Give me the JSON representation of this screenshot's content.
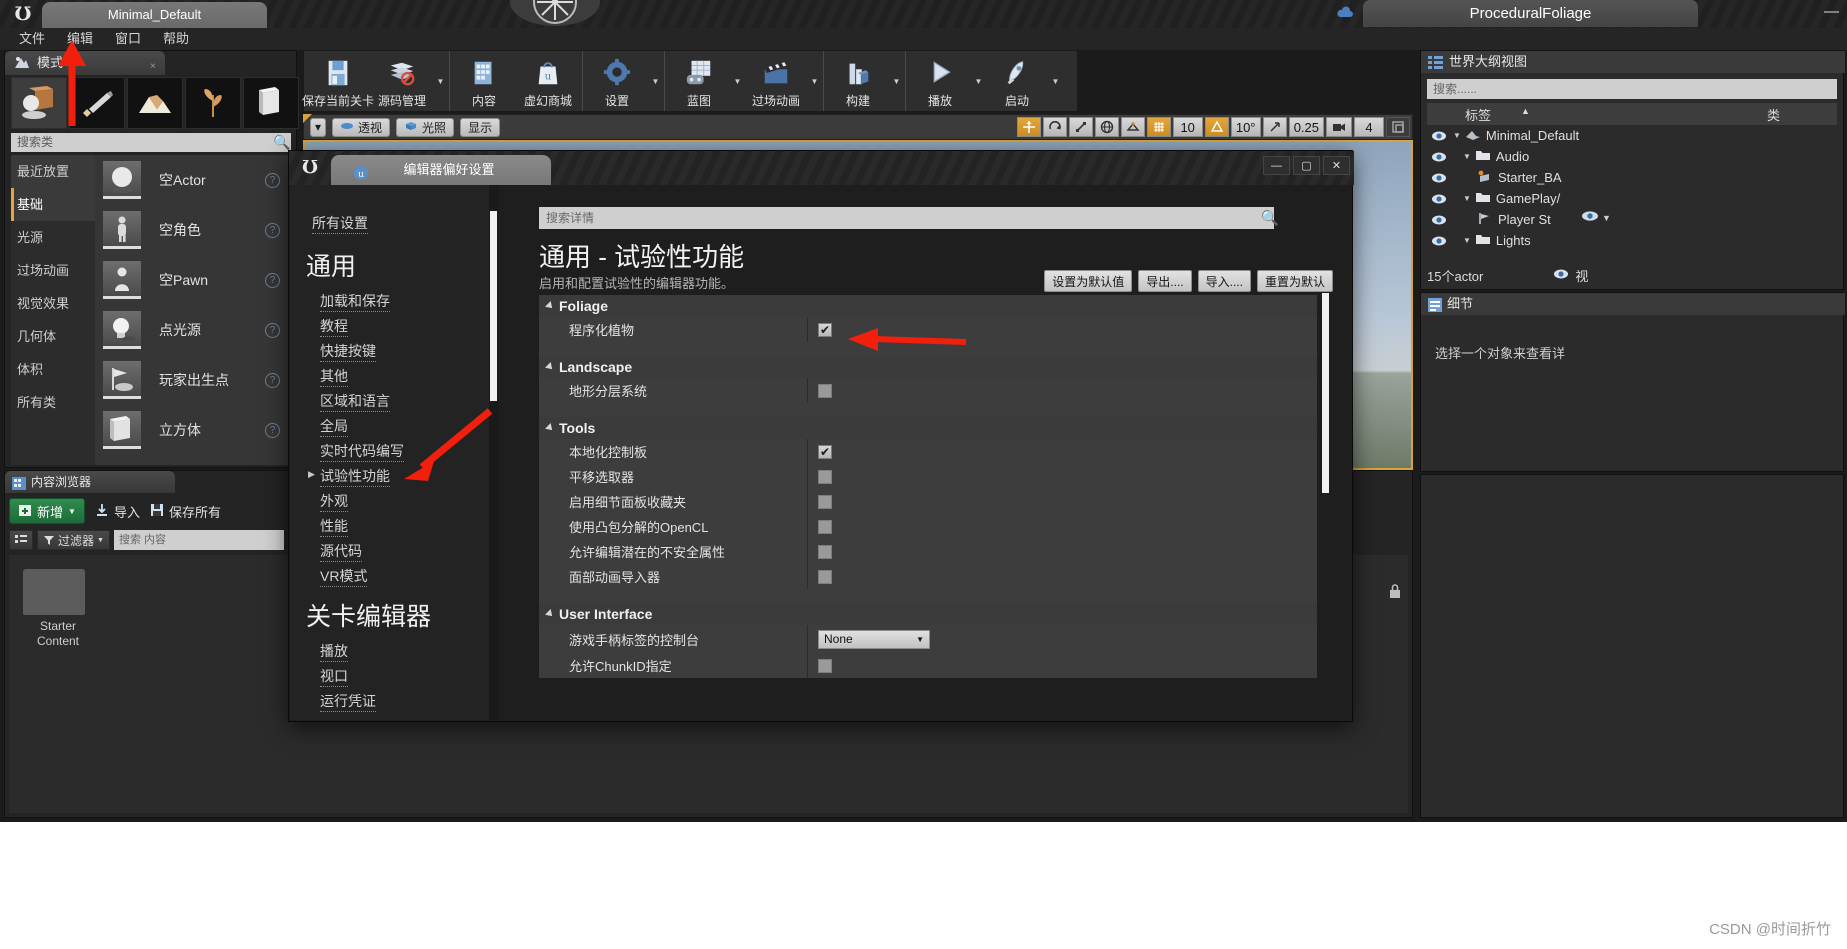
{
  "titlebar": {
    "project_tab": "Minimal_Default",
    "right_tab": "ProceduralFoliage",
    "logo": "Ʊ"
  },
  "menubar": {
    "items": [
      "文件",
      "编辑",
      "窗口",
      "帮助"
    ]
  },
  "modes_panel": {
    "tab_label": "模式",
    "close": "×",
    "mode_buttons": [
      {
        "name": "place-mode",
        "icon": "box-sphere"
      },
      {
        "name": "paint-mode",
        "icon": "brush"
      },
      {
        "name": "landscape-mode",
        "icon": "mountains"
      },
      {
        "name": "foliage-mode",
        "icon": "leaf"
      },
      {
        "name": "geometry-mode",
        "icon": "cube"
      }
    ],
    "search_placeholder": "搜索类",
    "categories": [
      "最近放置",
      "基础",
      "光源",
      "过场动画",
      "视觉效果",
      "几何体",
      "体积",
      "所有类"
    ],
    "active_category": "基础",
    "actors": [
      "空Actor",
      "空角色",
      "空Pawn",
      "点光源",
      "玩家出生点",
      "立方体"
    ]
  },
  "toolbar": {
    "groups": [
      {
        "buttons": [
          {
            "label": "保存当前关卡",
            "caret": false
          },
          {
            "label": "源码管理",
            "caret": true
          }
        ]
      },
      {
        "buttons": [
          {
            "label": "内容",
            "caret": false
          },
          {
            "label": "虚幻商城",
            "caret": false
          }
        ]
      },
      {
        "buttons": [
          {
            "label": "设置",
            "caret": true
          }
        ]
      },
      {
        "buttons": [
          {
            "label": "蓝图",
            "caret": true
          },
          {
            "label": "过场动画",
            "caret": true
          }
        ]
      },
      {
        "buttons": [
          {
            "label": "构建",
            "caret": true
          }
        ]
      },
      {
        "buttons": [
          {
            "label": "播放",
            "caret": true
          },
          {
            "label": "启动",
            "caret": true
          }
        ]
      }
    ]
  },
  "viewport_bar": {
    "pills": [
      "透视",
      "光照",
      "显示"
    ],
    "right_controls": [
      "10",
      "10°",
      "0.25",
      "4"
    ]
  },
  "content_browser": {
    "tab_label": "内容浏览器",
    "new_label": "新增",
    "import_label": "导入",
    "save_all_label": "保存所有",
    "filter_label": "过滤器",
    "search_placeholder": "搜索 内容",
    "folder_label": "Starter\nContent"
  },
  "world_outliner": {
    "title": "世界大纲视图",
    "search_placeholder": "搜索......",
    "col_label": "标签",
    "col_type": "类",
    "rows": [
      {
        "label": "Minimal_Default",
        "indent": 0,
        "icon": "level"
      },
      {
        "label": "Audio",
        "indent": 1,
        "icon": "folder"
      },
      {
        "label": "Starter_BA",
        "indent": 2,
        "icon": "audio"
      },
      {
        "label": "GamePlay/",
        "indent": 1,
        "icon": "folder"
      },
      {
        "label": "Player St",
        "indent": 2,
        "icon": "playerstart"
      },
      {
        "label": "Lights",
        "indent": 1,
        "icon": "folder"
      }
    ],
    "status": "15个actor",
    "status_right": "视"
  },
  "details_panel": {
    "title": "细节",
    "empty_message": "选择一个对象来查看详"
  },
  "dialog": {
    "tab_label": "编辑器偏好设置",
    "win_minimize": "—",
    "win_maximize": "▢",
    "win_close": "✕",
    "nav": {
      "all_settings": "所有设置",
      "section1_title": "通用",
      "section1_items": [
        "加载和保存",
        "教程",
        "快捷按键",
        "其他",
        "区域和语言",
        "全局",
        "实时代码编写",
        "试验性功能",
        "外观",
        "性能",
        "源代码",
        "VR模式"
      ],
      "section1_active": "试验性功能",
      "section2_title": "关卡编辑器",
      "section2_items": [
        "播放",
        "视口",
        "运行凭证"
      ]
    },
    "search_placeholder": "搜索详情",
    "page_title": "通用 - 试验性功能",
    "page_subtitle": "启用和配置试验性的编辑器功能。",
    "buttons": [
      "设置为默认值",
      "导出....",
      "导入....",
      "重置为默认"
    ],
    "groups": [
      {
        "name": "Foliage",
        "rows": [
          {
            "label": "程序化植物",
            "type": "checkbox",
            "checked": true
          }
        ]
      },
      {
        "name": "Landscape",
        "rows": [
          {
            "label": "地形分层系统",
            "type": "checkbox",
            "checked": false
          }
        ]
      },
      {
        "name": "Tools",
        "rows": [
          {
            "label": "本地化控制板",
            "type": "checkbox",
            "checked": true
          },
          {
            "label": "平移选取器",
            "type": "checkbox",
            "checked": false
          },
          {
            "label": "启用细节面板收藏夹",
            "type": "checkbox",
            "checked": false
          },
          {
            "label": "使用凸包分解的OpenCL",
            "type": "checkbox",
            "checked": false
          },
          {
            "label": "允许编辑潜在的不安全属性",
            "type": "checkbox",
            "checked": false
          },
          {
            "label": "面部动画导入器",
            "type": "checkbox",
            "checked": false
          }
        ]
      },
      {
        "name": "User Interface",
        "rows": [
          {
            "label": "游戏手柄标签的控制台",
            "type": "select",
            "value": "None"
          },
          {
            "label": "允许ChunkID指定",
            "type": "checkbox",
            "checked": false
          }
        ]
      }
    ]
  },
  "watermark": "CSDN @时间折竹",
  "colors": {
    "accent_orange": "#d8a43a",
    "arrow_red": "#f21f0c",
    "panel_bg": "#2b2b2b",
    "dialog_bg": "#1e1e1e",
    "row_bg": "#3d3d3d"
  }
}
